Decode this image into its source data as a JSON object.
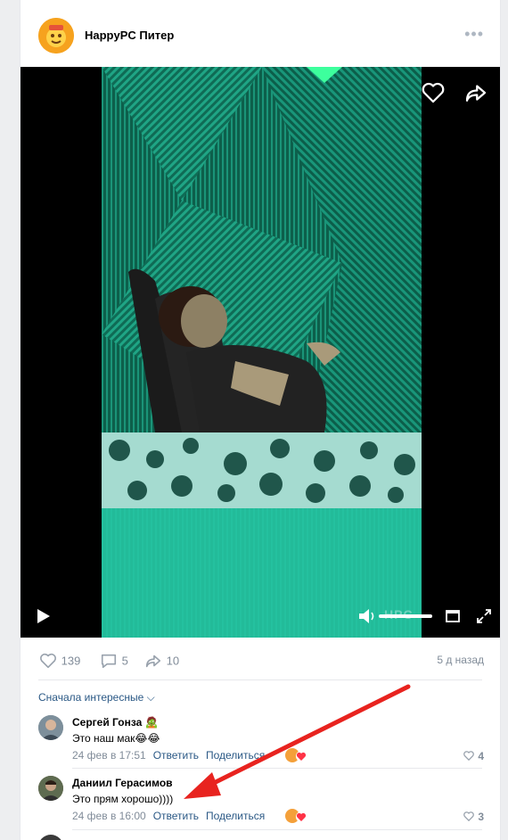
{
  "post": {
    "author": "HappyPC Питер",
    "more_icon": "•••",
    "video": {
      "watermark": "HPC"
    },
    "stats": {
      "likes": "139",
      "comments": "5",
      "shares": "10",
      "date": "5 д назад"
    },
    "sort_label": "Сначала интересные ⌵"
  },
  "comments": [
    {
      "name": "Сергей Гонза 🧟",
      "text": "Это наш мак😂😂",
      "date": "24 фев в 17:51",
      "reply": "Ответить",
      "share": "Поделиться",
      "likes": "4"
    },
    {
      "name": "Даниил Герасимов",
      "text": "Это прям хорошо))))",
      "date": "24 фев в 16:00",
      "reply": "Ответить",
      "share": "Поделиться",
      "likes": "3"
    }
  ],
  "colors": {
    "accent": "#2a5885",
    "muted": "#818c99",
    "video_green": "#1ec9a2",
    "arrow": "#e8231f"
  }
}
